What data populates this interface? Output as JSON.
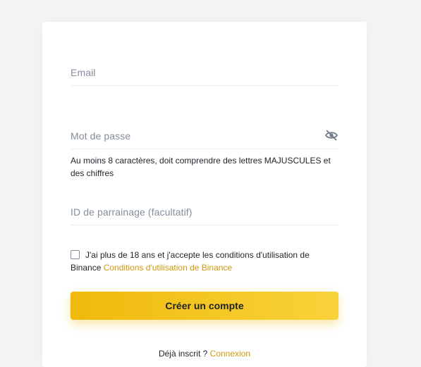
{
  "form": {
    "email": {
      "placeholder": "Email"
    },
    "password": {
      "placeholder": "Mot de passe",
      "toggle_icon": "eye-slash-icon",
      "hint": "Au moins 8 caractères, doit comprendre des lettres MAJUSCULES et des chiffres"
    },
    "referral": {
      "placeholder": "ID de parrainage (facultatif)"
    },
    "terms": {
      "text": "J'ai plus de 18 ans et j'accepte les conditions d'utilisation de Binance",
      "link_label": "Conditions d'utilisation de Binance"
    },
    "submit_label": "Créer un compte"
  },
  "footer": {
    "already_registered": "Déjà inscrit ?",
    "login_link": "Connexion"
  },
  "colors": {
    "accent": "#f0b90b",
    "link": "#d0980b",
    "text": "#1e2329",
    "placeholder": "#848e9c"
  }
}
